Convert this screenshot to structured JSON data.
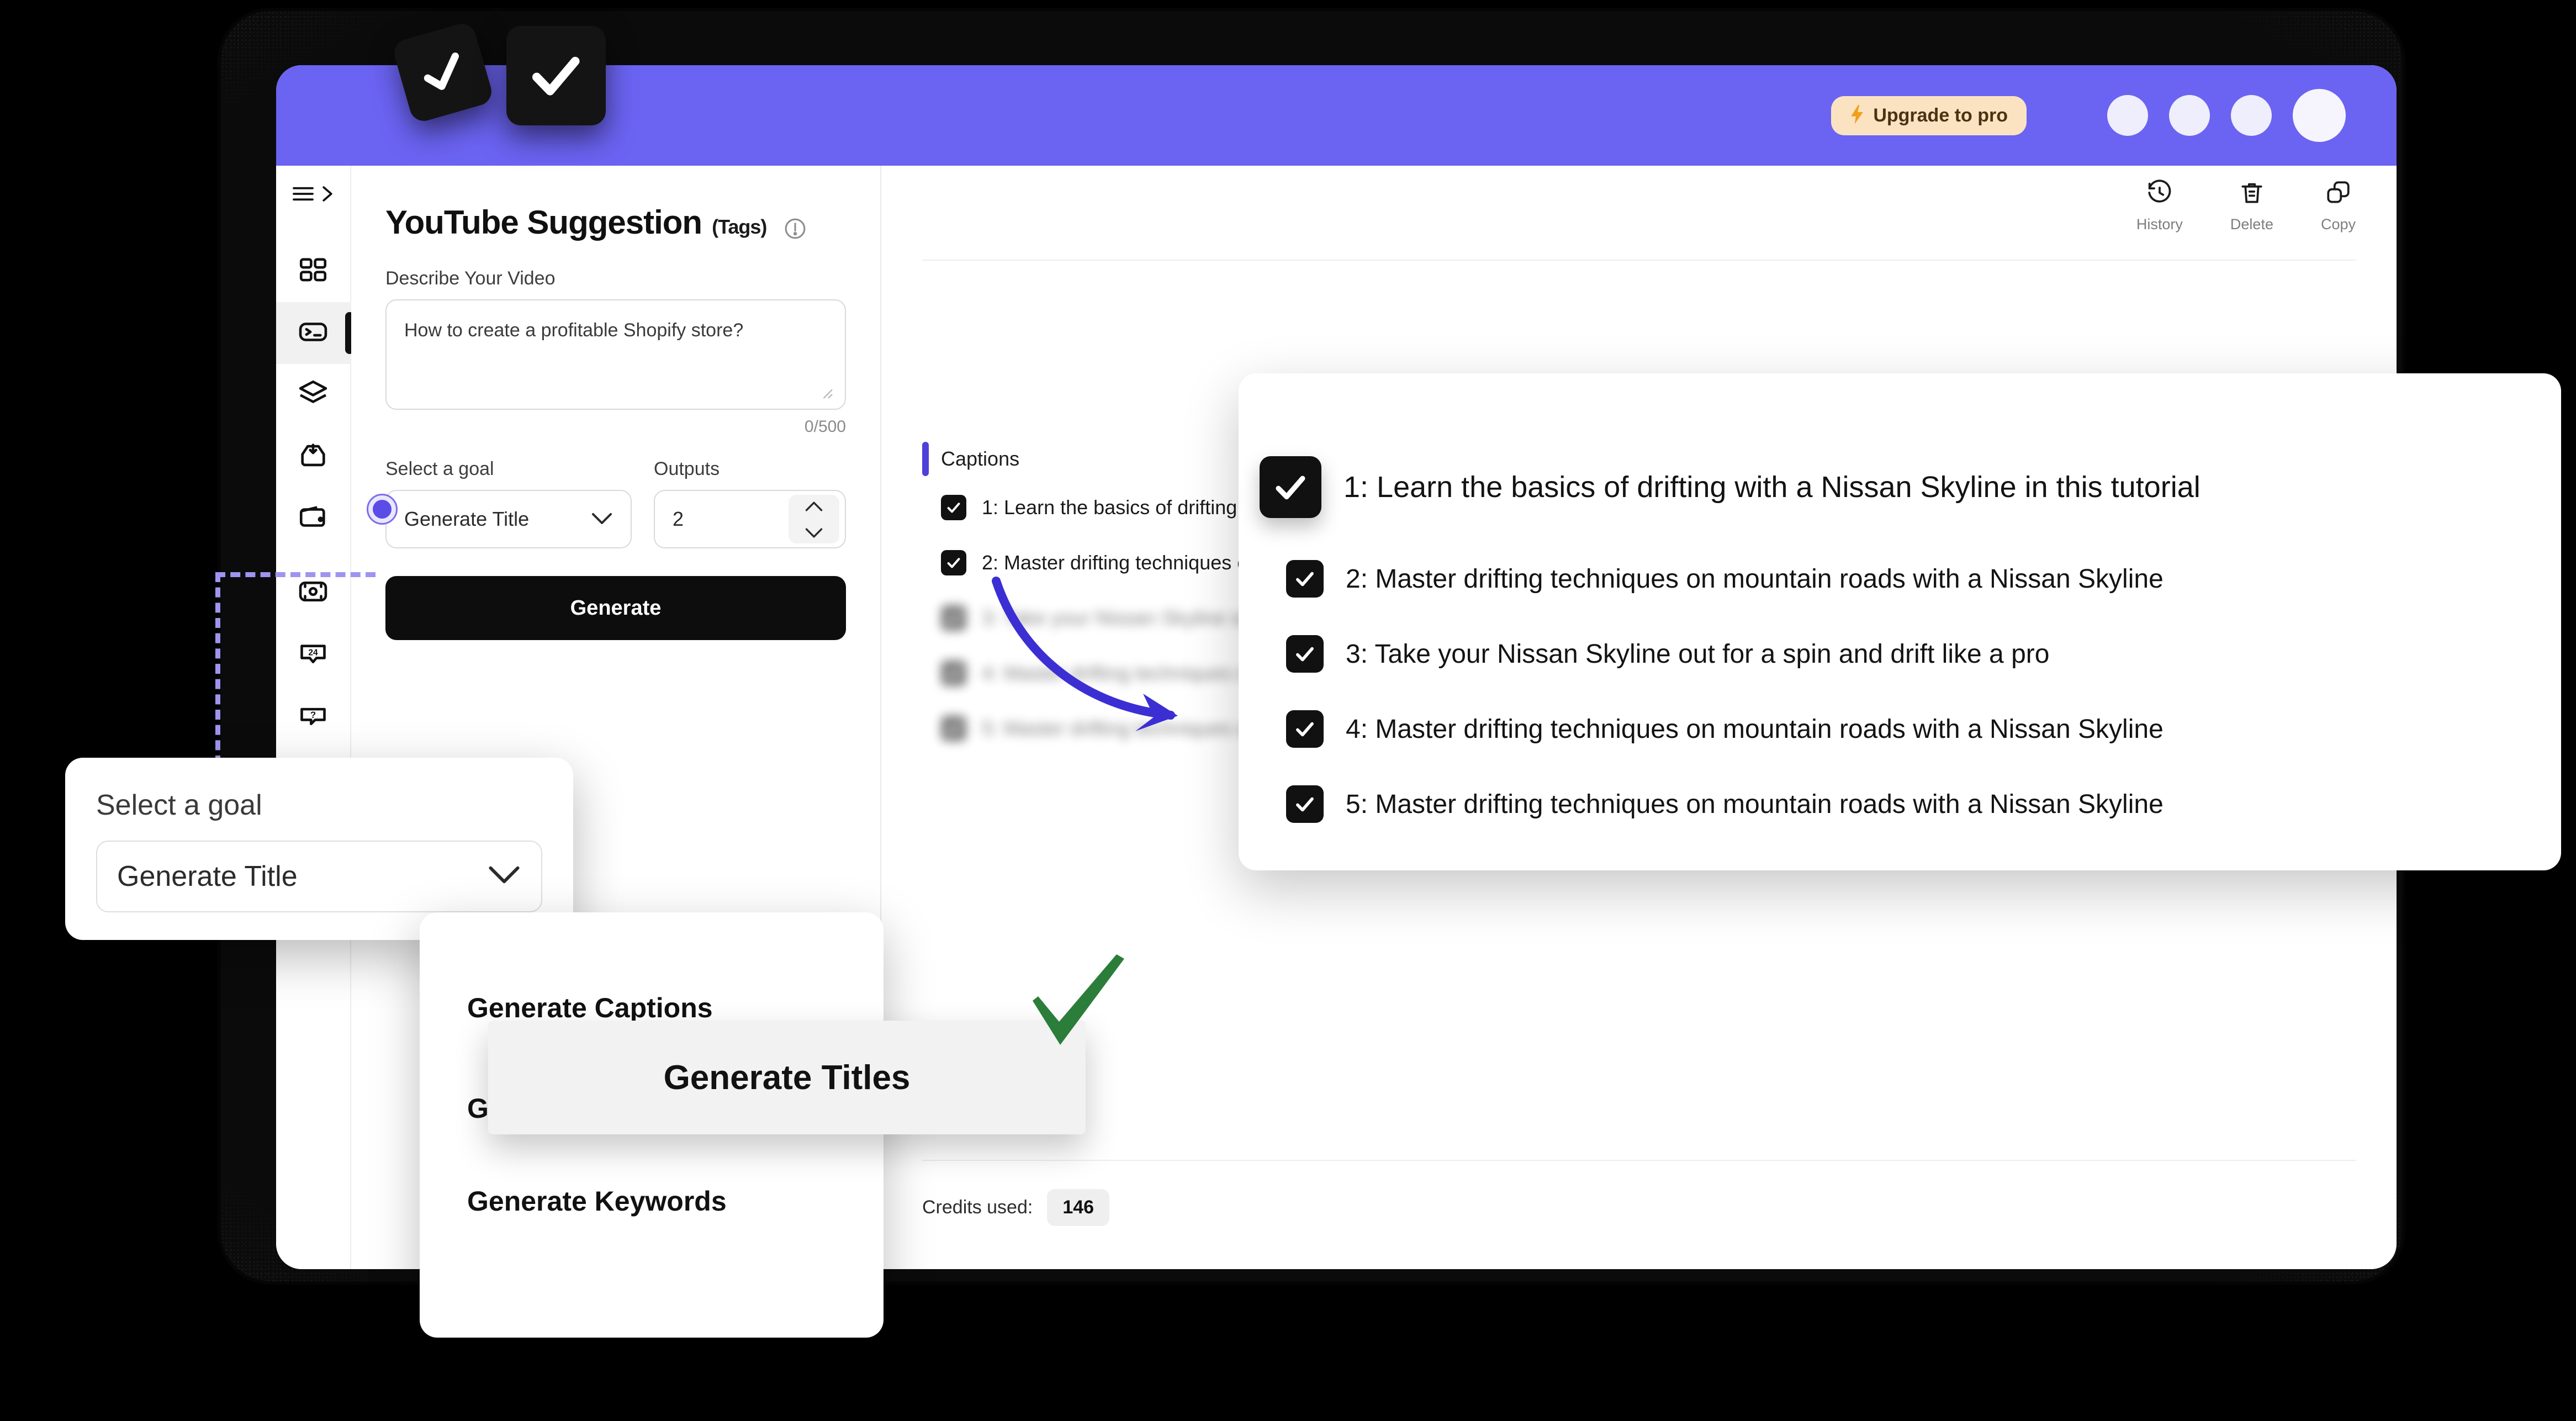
{
  "brand": {
    "purple": "#6B63F2",
    "accent_dark": "#4F40D8",
    "button_black": "#0D0D0D"
  },
  "topbar": {
    "upgrade_label": "Upgrade to pro",
    "bolt_icon": "bolt-icon",
    "avatar_count": 4
  },
  "sidebar": {
    "toggle_icon": "hamburger-icon",
    "expand_icon": "chevron-right-icon",
    "items": [
      {
        "icon": "grid-dashboard-icon",
        "active": false
      },
      {
        "icon": "terminal-icon",
        "active": true
      },
      {
        "icon": "layers-icon",
        "active": false
      },
      {
        "icon": "inbox-download-icon",
        "active": false
      },
      {
        "icon": "wallet-icon",
        "active": false
      },
      {
        "icon": "scan-image-icon",
        "active": false
      },
      {
        "icon": "badge-24-icon",
        "active": false
      },
      {
        "icon": "help-question-icon",
        "active": false
      }
    ]
  },
  "panel": {
    "title": "YouTube Suggestion",
    "title_suffix": "(Tags)",
    "info_icon": "info-circle-icon",
    "describe_label": "Describe Your Video",
    "describe_value": "How to create a profitable Shopify store?",
    "describe_counter": "0/500",
    "goal_label": "Select a goal",
    "goal_value": "Generate Title",
    "goal_chevron_icon": "chevron-down-icon",
    "outputs_label": "Outputs",
    "outputs_value": "2",
    "stepper_up_icon": "chevron-up-icon",
    "stepper_down_icon": "chevron-down-icon",
    "generate_label": "Generate"
  },
  "results": {
    "tools": [
      {
        "label": "History",
        "icon": "history-clock-icon"
      },
      {
        "label": "Delete",
        "icon": "trash-icon"
      },
      {
        "label": "Copy",
        "icon": "copy-icon"
      }
    ],
    "section_title": "Captions",
    "captions": [
      "1: Learn the basics of drifting with a Nissan Skyline in this tutorial",
      "2: Master drifting techniques on mountain roads with a Nissan Skyline",
      "3: Take your Nissan Skyline out for a spin and drift like a pro",
      "4: Master drifting techniques on mountain roads with a Nissan Skyline",
      "5: Master drifting techniques on mountain roads with a Nissan Skyline"
    ],
    "credits_label": "Credits used:",
    "credits_value": "146"
  },
  "overlay_goal": {
    "label": "Select a goal",
    "value": "Generate Title",
    "chevron_icon": "chevron-down-icon"
  },
  "overlay_menu": {
    "items": [
      "Generate Captions",
      "Generate Hashtags",
      "Generate Keywords"
    ],
    "highlighted": "Generate Titles"
  },
  "overlay_captions": {
    "items": [
      "1: Learn the basics of drifting with a Nissan Skyline in this tutorial",
      "2: Master drifting techniques on mountain roads with a Nissan Skyline",
      "3: Take your Nissan Skyline out for a spin and drift like a pro",
      "4: Master drifting techniques on mountain roads with a Nissan Skyline",
      "5: Master drifting techniques on mountain roads with a Nissan Skyline"
    ],
    "check_icon": "checkmark-icon"
  },
  "decorations": {
    "sticker_icon": "check-sticker-icon",
    "arrow_icon": "curved-arrow-icon",
    "green_check_icon": "green-checkmark-icon",
    "arrow_color": "#3B2FD4",
    "green_color": "#2B7D3A",
    "dashed_color": "#9E94F0"
  }
}
